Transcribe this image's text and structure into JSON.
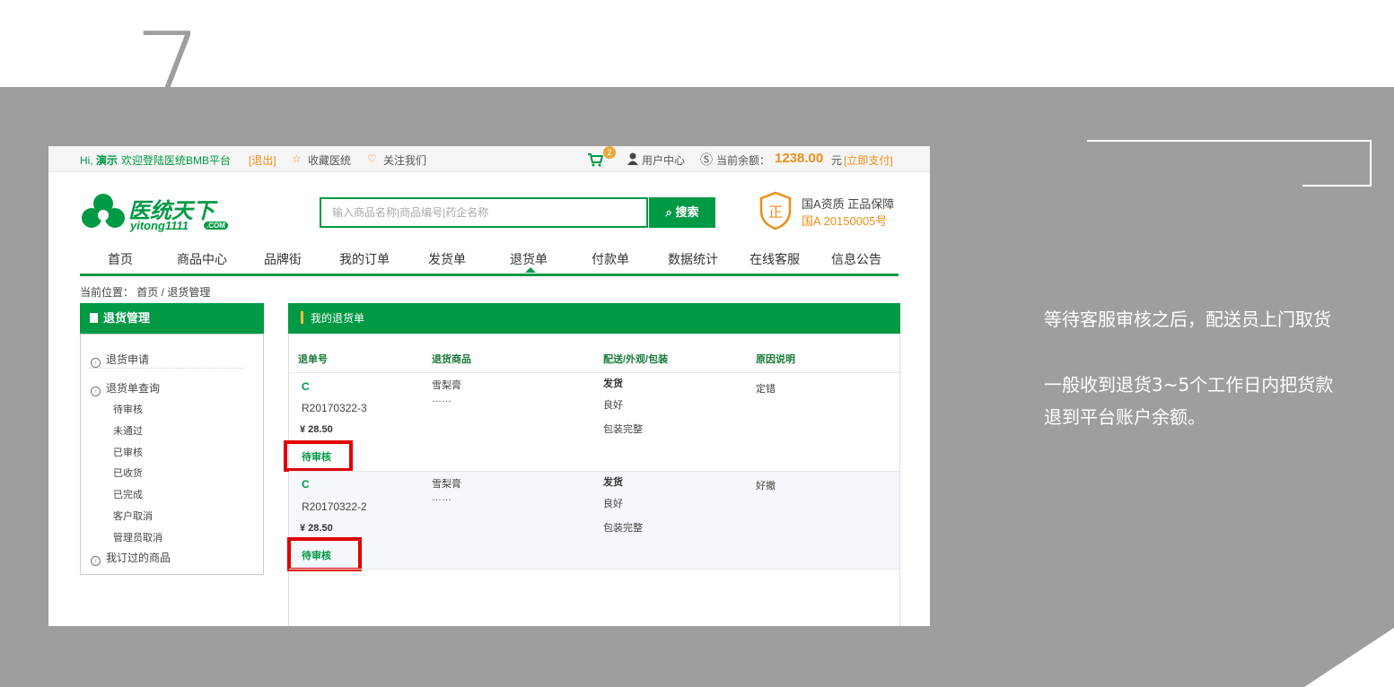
{
  "slide": {
    "step_number": "7",
    "note_line1": "等待客服审核之后，配送员上门取货",
    "note_line2": "一般收到退货3~5个工作日内把货款",
    "note_line3": "退到平台账户余额。"
  },
  "topbar": {
    "greeting_hi": "Hi,",
    "username": "演示",
    "welcome": "欢迎登陆医统BMB平台",
    "logout": "[退出]",
    "favorite": "收藏医统",
    "follow": "关注我们",
    "cart_count": "2",
    "user_center": "用户中心",
    "balance_label": "当前余额：",
    "balance_value": "1238.00",
    "balance_unit": "元",
    "pay_now": "[立即支付]"
  },
  "header": {
    "logo_cn": "医统天下",
    "logo_en": "yitong1111",
    "logo_com": ".COM",
    "search_placeholder": "输入商品名称|商品编号|药企名称",
    "search_button": "搜索",
    "shield_char": "正",
    "qual_line1": "国A资质 正品保障",
    "qual_line2": "国A  20150005号"
  },
  "nav": {
    "items": [
      "首页",
      "商品中心",
      "品牌街",
      "我的订单",
      "发货单",
      "退货单",
      "付款单",
      "数据统计",
      "在线客服",
      "信息公告"
    ],
    "active_index": 5
  },
  "breadcrumb": "当前位置：  首页 / 退货管理",
  "sidebar": {
    "title": "退货管理",
    "links": [
      "退货申请",
      "退货单查询",
      "我订过的商品"
    ],
    "sub_items": [
      "待审核",
      "未通过",
      "已审核",
      "已收货",
      "已完成",
      "客户取消",
      "管理员取消"
    ]
  },
  "main": {
    "title": "我的退货单",
    "columns": [
      "退单号",
      "退货商品",
      "配送/外观/包装",
      "原因说明"
    ],
    "rows": [
      {
        "prefix": "C",
        "order_no": "R20170322-3",
        "price": "¥ 28.50",
        "status": "待审核",
        "product": "雪梨膏",
        "product_more": "……",
        "delivery": "发货",
        "appearance": "良好",
        "packaging": "包装完整",
        "reason": "定错"
      },
      {
        "prefix": "C",
        "order_no": "R20170322-2",
        "price": "¥ 28.50",
        "status": "待审核",
        "product": "雪梨膏",
        "product_more": "……",
        "delivery": "发货",
        "appearance": "良好",
        "packaging": "包装完整",
        "reason": "好撤"
      }
    ]
  },
  "colors": {
    "green": "#009944",
    "orange": "#e9901a",
    "highlight": "#e00000",
    "slide_gray": "#9e9e9e"
  }
}
